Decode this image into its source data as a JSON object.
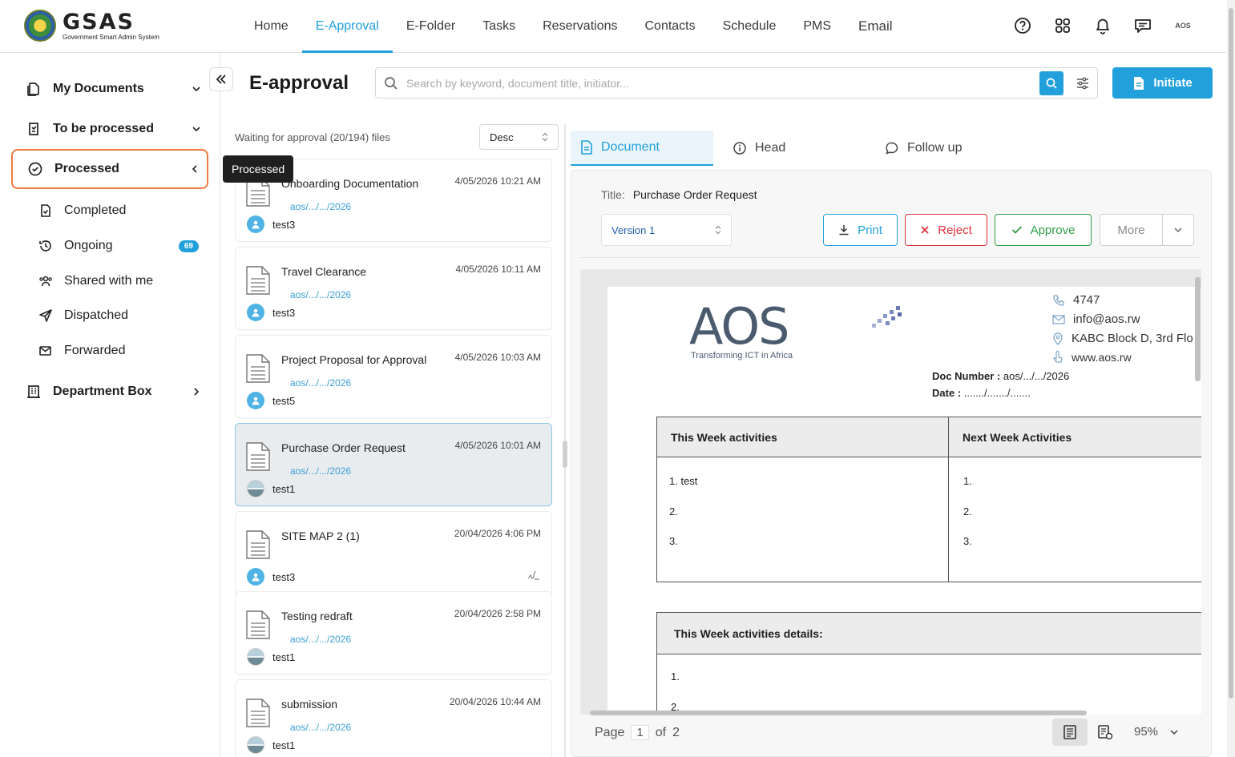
{
  "app": {
    "name": "GSAS",
    "subtitle": "Government Smart Admin System",
    "avatar_text": "AOS"
  },
  "nav": {
    "items": [
      "Home",
      "E-Approval",
      "E-Folder",
      "Tasks",
      "Reservations",
      "Contacts",
      "Schedule",
      "PMS",
      "Email"
    ],
    "active": "E-Approval"
  },
  "top_icons": [
    "help-icon",
    "apps-grid-icon",
    "bell-icon",
    "chat-icon"
  ],
  "sidebar": {
    "main": [
      {
        "label": "My Documents",
        "icon": "documents-icon"
      },
      {
        "label": "To be processed",
        "icon": "clipboard-icon"
      },
      {
        "label": "Processed",
        "icon": "check-circle-icon"
      },
      {
        "label": "Department Box",
        "icon": "building-icon"
      }
    ],
    "sub": [
      {
        "label": "Completed",
        "icon": "file-check-icon"
      },
      {
        "label": "Ongoing",
        "icon": "history-icon",
        "badge": "69"
      },
      {
        "label": "Shared with me",
        "icon": "users-icon"
      },
      {
        "label": "Dispatched",
        "icon": "send-icon"
      },
      {
        "label": "Forwarded",
        "icon": "mail-forward-icon"
      }
    ],
    "tooltip": "Processed"
  },
  "page": {
    "title": "E-approval",
    "search_placeholder": "Search by keyword, document title, initiator...",
    "initiate_label": "Initiate"
  },
  "list": {
    "header": "Waiting for approval (20/194) files",
    "sort": "Desc",
    "items": [
      {
        "title": "Onboarding Documentation",
        "date": "4/05/2026 10:21 AM",
        "ref": "aos/.../.../2026",
        "user": "test3",
        "avatar": "dot"
      },
      {
        "title": "Travel Clearance",
        "date": "4/05/2026 10:11 AM",
        "ref": "aos/.../.../2026",
        "user": "test3",
        "avatar": "dot"
      },
      {
        "title": "Project Proposal for Approval",
        "date": "4/05/2026 10:03 AM",
        "ref": "aos/.../.../2026",
        "user": "test5",
        "avatar": "dot"
      },
      {
        "title": "Purchase Order Request",
        "date": "4/05/2026 10:01 AM",
        "ref": "aos/.../.../2026",
        "user": "test1",
        "avatar": "photo"
      },
      {
        "title": "SITE MAP 2 (1)",
        "date": "20/04/2026 4:06 PM",
        "ref": "",
        "user": "test3",
        "avatar": "dot"
      },
      {
        "title": "Testing redraft",
        "date": "20/04/2026 2:58 PM",
        "ref": "aos/.../.../2026",
        "user": "test1",
        "avatar": "photo"
      },
      {
        "title": "submission",
        "date": "20/04/2026 10:44 AM",
        "ref": "aos/.../.../2026",
        "user": "test1",
        "avatar": "photo"
      }
    ]
  },
  "detail": {
    "tabs": [
      "Document",
      "Head",
      "Follow up"
    ],
    "title_key": "Title:",
    "title_value": "Purchase Order Request",
    "version": "Version 1",
    "buttons": {
      "print": "Print",
      "reject": "Reject",
      "approve": "Approve",
      "more": "More"
    }
  },
  "doc": {
    "logo": "AOS",
    "tagline": "Transforming ICT in Africa",
    "phone": "4747",
    "email": "info@aos.rw",
    "address": "KABC Block D, 3rd Flo",
    "website": "www.aos.rw",
    "doc_number_label": "Doc  Number  :",
    "doc_number_value": "aos/.../.../2026",
    "date_label": "Date  :",
    "date_value": "......./......./.......",
    "table1": {
      "headers": [
        "This Week activities",
        "Next Week Activities"
      ],
      "left": [
        "1. test",
        "2.",
        "3."
      ],
      "right": [
        "1.",
        "2.",
        "3."
      ]
    },
    "table2": {
      "header": "This Week activities details:",
      "rows": [
        "1.",
        "2."
      ]
    }
  },
  "pager": {
    "label": "Page",
    "current": "1",
    "of": "of",
    "total": "2",
    "zoom": "95%"
  }
}
